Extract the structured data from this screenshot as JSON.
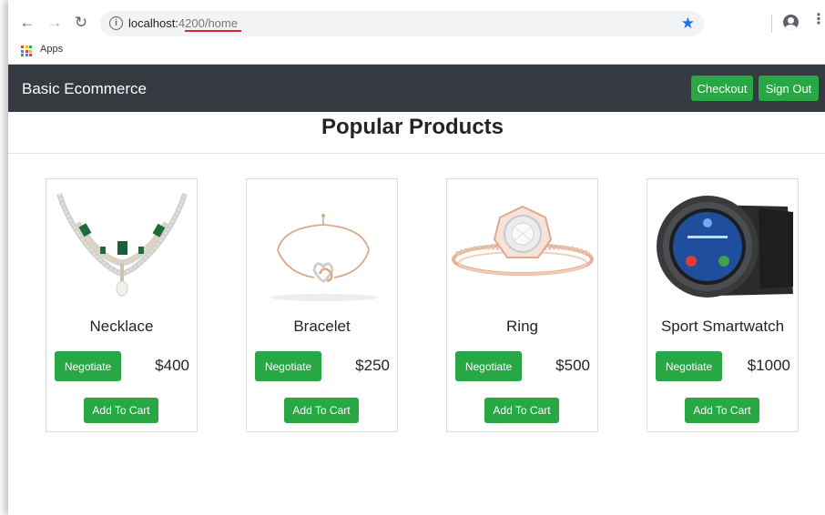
{
  "browser": {
    "url_host": "localhost:",
    "url_path": "4200/home",
    "bookmarks": {
      "apps_label": "Apps"
    }
  },
  "navbar": {
    "brand": "Basic Ecommerce",
    "checkout_label": "Checkout",
    "signout_label": "Sign Out"
  },
  "page": {
    "title": "Popular Products"
  },
  "products": [
    {
      "name": "Necklace",
      "price": "$400",
      "negotiate_label": "Negotiate",
      "cart_label": "Add To Cart"
    },
    {
      "name": "Bracelet",
      "price": "$250",
      "negotiate_label": "Negotiate",
      "cart_label": "Add To Cart"
    },
    {
      "name": "Ring",
      "price": "$500",
      "negotiate_label": "Negotiate",
      "cart_label": "Add To Cart"
    },
    {
      "name": "Sport Smartwatch",
      "price": "$1000",
      "negotiate_label": "Negotiate",
      "cart_label": "Add To Cart"
    }
  ],
  "colors": {
    "navbar": "#343a40",
    "button_green": "#28a745",
    "star_blue": "#1a73e8",
    "url_underline": "#d62a2a"
  }
}
